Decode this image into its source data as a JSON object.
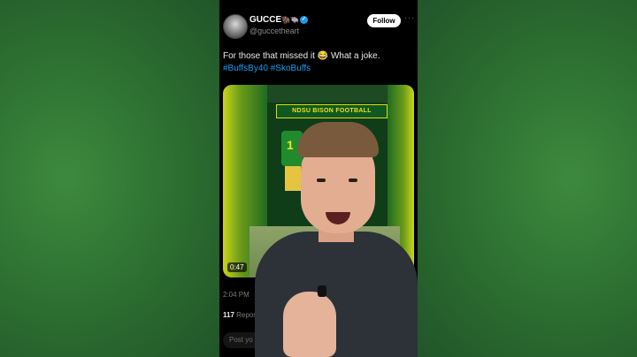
{
  "post": {
    "display_name": "GUCCE",
    "name_emojis": "🦬🐃",
    "handle": "@guccetheart",
    "follow_label": "Follow",
    "more_icon": "more-dots-icon",
    "text": "For those that missed it 😂 What a joke.",
    "hashtags": "#BuffsBy40 #SkoBuffs",
    "timestamp": "2:04 PM",
    "reposts_count": "117",
    "reposts_label": "Repos",
    "reply_placeholder": "Post yo"
  },
  "media": {
    "duration": "0:47",
    "sign_text": "NDSU BISON FOOTBALL",
    "jersey_number": "1"
  },
  "colors": {
    "accent": "#1d9bf0",
    "background_green": "#2f6b34"
  }
}
